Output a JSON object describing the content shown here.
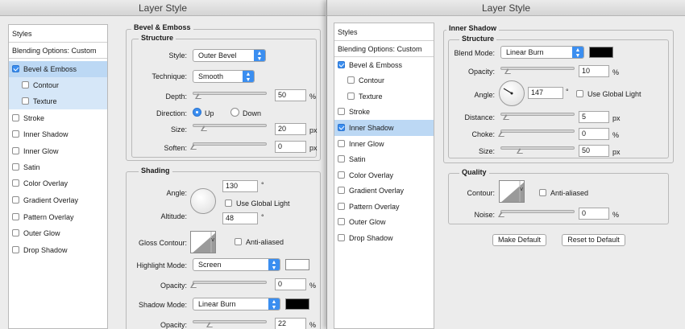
{
  "left": {
    "title": "Layer Style",
    "styles": {
      "header": "Styles",
      "blending": "Blending Options: Custom",
      "items": [
        {
          "label": "Bevel & Emboss",
          "checked": true
        },
        {
          "label": "Contour",
          "checked": false
        },
        {
          "label": "Texture",
          "checked": false
        },
        {
          "label": "Stroke",
          "checked": false
        },
        {
          "label": "Inner Shadow",
          "checked": false
        },
        {
          "label": "Inner Glow",
          "checked": false
        },
        {
          "label": "Satin",
          "checked": false
        },
        {
          "label": "Color Overlay",
          "checked": false
        },
        {
          "label": "Gradient Overlay",
          "checked": false
        },
        {
          "label": "Pattern Overlay",
          "checked": false
        },
        {
          "label": "Outer Glow",
          "checked": false
        },
        {
          "label": "Drop Shadow",
          "checked": false
        }
      ]
    },
    "bevel": {
      "section": "Bevel & Emboss",
      "structure": "Structure",
      "style_label": "Style:",
      "style_value": "Outer Bevel",
      "technique_label": "Technique:",
      "technique_value": "Smooth",
      "depth_label": "Depth:",
      "depth_value": "50",
      "depth_unit": "%",
      "direction_label": "Direction:",
      "dir_up": "Up",
      "dir_down": "Down",
      "size_label": "Size:",
      "size_value": "20",
      "size_unit": "px",
      "soften_label": "Soften:",
      "soften_value": "0",
      "soften_unit": "px"
    },
    "shading": {
      "section": "Shading",
      "angle_label": "Angle:",
      "angle_value": "130",
      "deg": "°",
      "global_light": "Use Global Light",
      "altitude_label": "Altitude:",
      "altitude_value": "48",
      "gloss_label": "Gloss Contour:",
      "anti_aliased": "Anti-aliased",
      "highlight_label": "Highlight Mode:",
      "highlight_value": "Screen",
      "opacity_label": "Opacity:",
      "opacity_value": "0",
      "opacity_unit": "%",
      "shadow_label": "Shadow Mode:",
      "shadow_value": "Linear Burn",
      "opacity2_label": "Opacity:",
      "opacity2_value": "22",
      "opacity2_unit": "%"
    }
  },
  "right": {
    "title": "Layer Style",
    "styles": {
      "header": "Styles",
      "blending": "Blending Options: Custom",
      "items": [
        {
          "label": "Bevel & Emboss",
          "checked": true
        },
        {
          "label": "Contour",
          "checked": false
        },
        {
          "label": "Texture",
          "checked": false
        },
        {
          "label": "Stroke",
          "checked": false
        },
        {
          "label": "Inner Shadow",
          "checked": true
        },
        {
          "label": "Inner Glow",
          "checked": false
        },
        {
          "label": "Satin",
          "checked": false
        },
        {
          "label": "Color Overlay",
          "checked": false
        },
        {
          "label": "Gradient Overlay",
          "checked": false
        },
        {
          "label": "Pattern Overlay",
          "checked": false
        },
        {
          "label": "Outer Glow",
          "checked": false
        },
        {
          "label": "Drop Shadow",
          "checked": false
        }
      ]
    },
    "inner_shadow": {
      "section": "Inner Shadow",
      "structure": "Structure",
      "blend_label": "Blend Mode:",
      "blend_value": "Linear Burn",
      "opacity_label": "Opacity:",
      "opacity_value": "10",
      "opacity_unit": "%",
      "angle_label": "Angle:",
      "angle_value": "147",
      "deg": "°",
      "global_light": "Use Global Light",
      "distance_label": "Distance:",
      "distance_value": "5",
      "distance_unit": "px",
      "choke_label": "Choke:",
      "choke_value": "0",
      "choke_unit": "%",
      "size_label": "Size:",
      "size_value": "50",
      "size_unit": "px"
    },
    "quality": {
      "section": "Quality",
      "contour_label": "Contour:",
      "anti_aliased": "Anti-aliased",
      "noise_label": "Noise:",
      "noise_value": "0",
      "noise_unit": "%"
    },
    "buttons": {
      "make_default": "Make Default",
      "reset_default": "Reset to Default"
    }
  },
  "colors": {
    "selection": "#bcd8f4",
    "accent": "#3b8ef0",
    "highlight_color": "#ffffff",
    "shadow_color": "#000000"
  }
}
